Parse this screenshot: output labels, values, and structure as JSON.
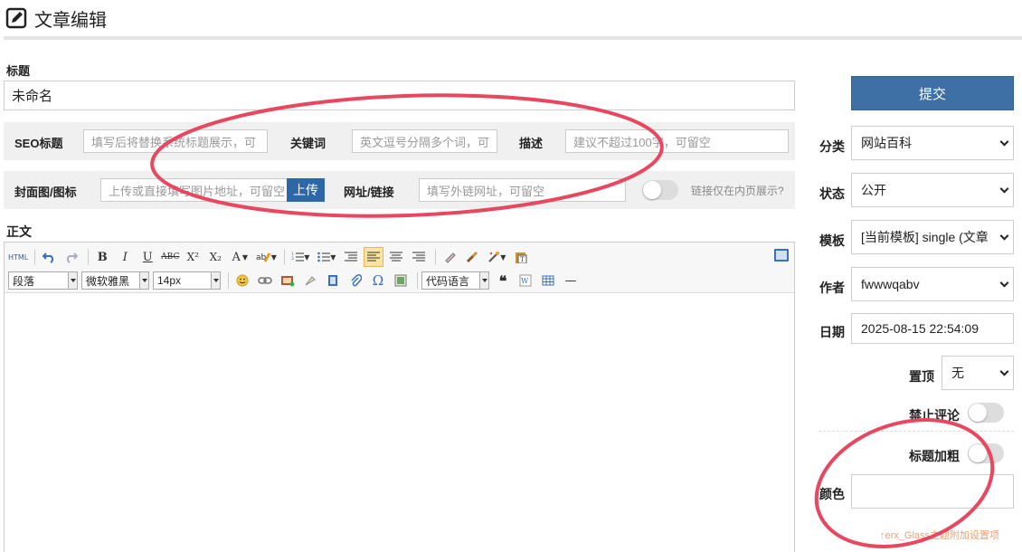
{
  "header": {
    "title": "文章编辑",
    "icon": "edit-icon"
  },
  "title_field": {
    "label": "标题",
    "value": "未命名"
  },
  "seo_row": {
    "seo_title_label": "SEO标题",
    "seo_title_placeholder": "填写后将替换系统标题展示，可",
    "keywords_label": "关键词",
    "keywords_placeholder": "英文逗号分隔多个词，可",
    "description_label": "描述",
    "description_placeholder": "建议不超过100字，可留空"
  },
  "cover_row": {
    "cover_label": "封面图/图标",
    "cover_placeholder": "上传或直接填写图片地址，可留空",
    "upload_label": "上传",
    "link_label": "网址/链接",
    "link_placeholder": "填写外链网址，可留空",
    "link_toggle_text": "链接仅在内页展示?"
  },
  "content": {
    "label": "正文"
  },
  "toolbar": {
    "html_label": "HTML",
    "paragraph_value": "段落",
    "font_value": "微软雅黑",
    "size_value": "14px",
    "code_lang_value": "代码语言",
    "bold": "B",
    "italic": "I",
    "underline": "U",
    "strike": "ABC",
    "sup": "X²",
    "sub": "X₂",
    "font_color": "A",
    "omega": "Ω",
    "quote": "❝",
    "hr": "—"
  },
  "sidebar": {
    "submit_label": "提交",
    "category_label": "分类",
    "category_value": "网站百科",
    "status_label": "状态",
    "status_value": "公开",
    "template_label": "模板",
    "template_value": "[当前模板] single (文章",
    "author_label": "作者",
    "author_value": "fwwwqabv",
    "date_label": "日期",
    "date_value": "2025-08-15 22:54:09",
    "sticky_label": "置顶",
    "sticky_value": "无",
    "disable_comment_label": "禁止评论",
    "bold_title_label": "标题加粗",
    "color_label": "颜色",
    "theme_note": "↑erx_Glass主题附加设置项"
  },
  "colors": {
    "accent": "#3e6fa5",
    "annotation": "#e8475f"
  }
}
